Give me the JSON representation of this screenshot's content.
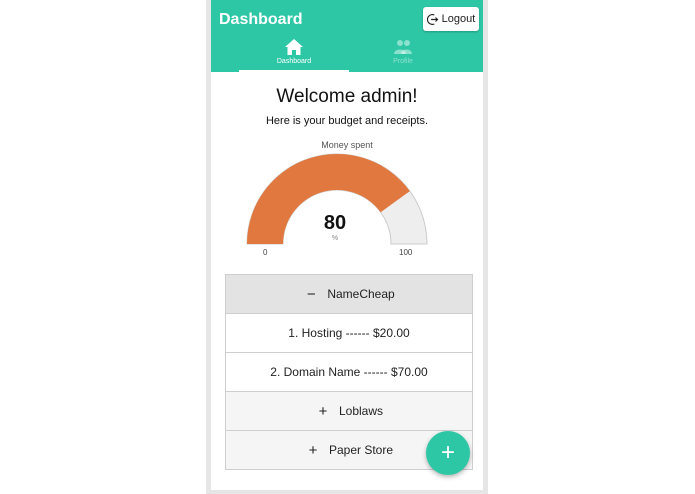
{
  "header": {
    "title": "Dashboard",
    "logout_label": "Logout"
  },
  "tabs": [
    {
      "label": "Dashboard",
      "icon": "home-icon",
      "active": true
    },
    {
      "label": "Profile",
      "icon": "people-icon",
      "active": false
    }
  ],
  "main": {
    "welcome": "Welcome admin!",
    "subtitle": "Here is your budget and receipts."
  },
  "gauge": {
    "label": "Money spent",
    "value": "80",
    "unit": "%",
    "min": "0",
    "max": "100",
    "fill_color": "#e07840",
    "track_color": "#eeeeee"
  },
  "accordion": [
    {
      "title": "NameCheap",
      "expanded": true,
      "items": [
        "1. Hosting ------ $20.00",
        "2. Domain Name ------ $70.00"
      ]
    },
    {
      "title": "Loblaws",
      "expanded": false,
      "items": []
    },
    {
      "title": "Paper Store",
      "expanded": false,
      "items": []
    }
  ],
  "fab": {
    "label": "+"
  },
  "colors": {
    "primary": "#2ec7a6",
    "accent": "#e07840"
  }
}
